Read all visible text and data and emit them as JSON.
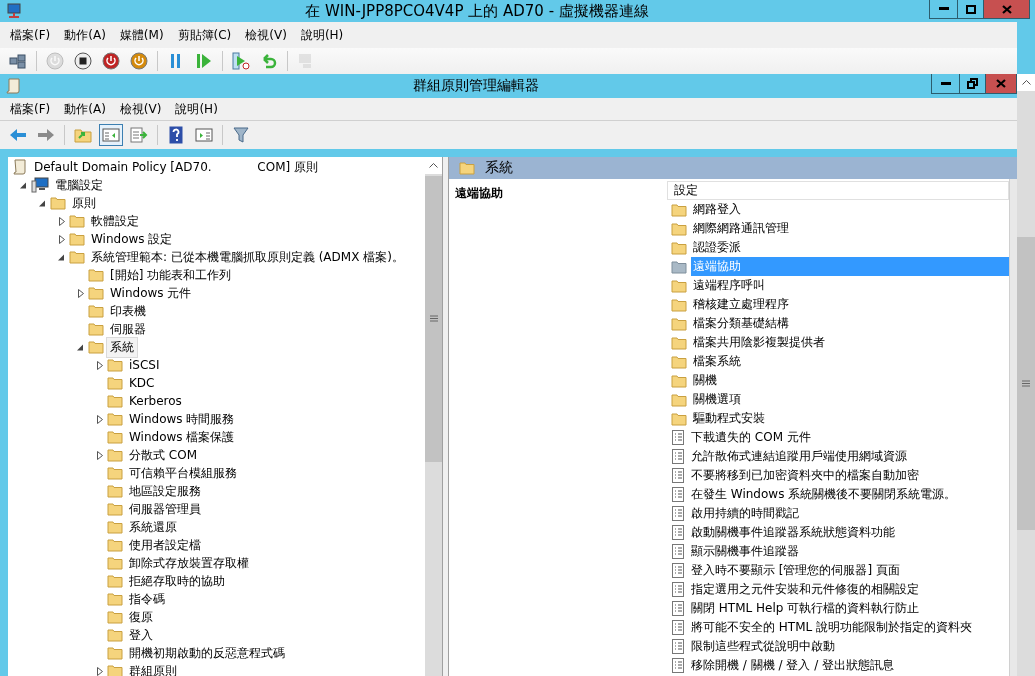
{
  "vm_window": {
    "title": "在 WIN-JPP8PCO4V4P 上的 AD70 - 虛擬機器連線",
    "menu": [
      "檔案(F)",
      "動作(A)",
      "媒體(M)",
      "剪貼簿(C)",
      "檢視(V)",
      "說明(H)"
    ],
    "toolbar": [
      [
        {
          "kind": "ctrl-alt-del",
          "disabled": false
        }
      ],
      [
        {
          "kind": "start",
          "disabled": true
        },
        {
          "kind": "stop",
          "disabled": false
        },
        {
          "kind": "shutdown",
          "disabled": false
        },
        {
          "kind": "save",
          "disabled": false
        }
      ],
      [
        {
          "kind": "pause",
          "disabled": false
        },
        {
          "kind": "resume",
          "disabled": false
        }
      ],
      [
        {
          "kind": "checkpoint",
          "disabled": false
        },
        {
          "kind": "revert",
          "disabled": false
        }
      ],
      [
        {
          "kind": "session",
          "disabled": true
        }
      ]
    ]
  },
  "editor_window": {
    "title": "群組原則管理編輯器",
    "menu": [
      "檔案(F)",
      "動作(A)",
      "檢視(V)",
      "說明(H)"
    ],
    "toolbar": [
      [
        {
          "kind": "back",
          "pressed": false
        },
        {
          "kind": "forward",
          "pressed": false
        }
      ],
      [
        {
          "kind": "up",
          "pressed": false
        },
        {
          "kind": "tree",
          "pressed": true
        },
        {
          "kind": "export",
          "pressed": false
        }
      ],
      [
        {
          "kind": "help",
          "pressed": false
        },
        {
          "kind": "pane",
          "pressed": false
        }
      ],
      [
        {
          "kind": "filter",
          "pressed": false
        }
      ]
    ]
  },
  "tree": [
    {
      "label": "Default Domain Policy [AD70.            COM] 原則",
      "kind": "policy",
      "selected": false,
      "children": [
        {
          "label": "電腦設定",
          "kind": "computer",
          "expanded": true,
          "selected": false,
          "children": [
            {
              "label": "原則",
              "kind": "folder",
              "expanded": true,
              "selected": false,
              "children": [
                {
                  "label": "軟體設定",
                  "kind": "folder",
                  "expanded": false,
                  "selected": false
                },
                {
                  "label": "Windows 設定",
                  "kind": "folder",
                  "expanded": false,
                  "selected": false
                },
                {
                  "label": "系統管理範本: 已從本機電腦抓取原則定義 (ADMX 檔案)。",
                  "kind": "folder",
                  "expanded": true,
                  "selected": false,
                  "children": [
                    {
                      "label": "[開始] 功能表和工作列",
                      "kind": "folder",
                      "selected": false
                    },
                    {
                      "label": "Windows 元件",
                      "kind": "folder",
                      "expanded": false,
                      "selected": false
                    },
                    {
                      "label": "印表機",
                      "kind": "folder",
                      "selected": false
                    },
                    {
                      "label": "伺服器",
                      "kind": "folder",
                      "selected": false
                    },
                    {
                      "label": "系統",
                      "kind": "folder",
                      "expanded": true,
                      "selected": true,
                      "children": [
                        {
                          "label": "iSCSI",
                          "kind": "folder",
                          "expanded": false,
                          "selected": false
                        },
                        {
                          "label": "KDC",
                          "kind": "folder",
                          "selected": false
                        },
                        {
                          "label": "Kerberos",
                          "kind": "folder",
                          "selected": false
                        },
                        {
                          "label": "Windows 時間服務",
                          "kind": "folder",
                          "expanded": false,
                          "selected": false
                        },
                        {
                          "label": "Windows 檔案保護",
                          "kind": "folder",
                          "selected": false
                        },
                        {
                          "label": "分散式 COM",
                          "kind": "folder",
                          "expanded": false,
                          "selected": false
                        },
                        {
                          "label": "可信賴平台模組服務",
                          "kind": "folder",
                          "selected": false
                        },
                        {
                          "label": "地區設定服務",
                          "kind": "folder",
                          "selected": false
                        },
                        {
                          "label": "伺服器管理員",
                          "kind": "folder",
                          "selected": false
                        },
                        {
                          "label": "系統還原",
                          "kind": "folder",
                          "selected": false
                        },
                        {
                          "label": "使用者設定檔",
                          "kind": "folder",
                          "selected": false
                        },
                        {
                          "label": "卸除式存放裝置存取權",
                          "kind": "folder",
                          "selected": false
                        },
                        {
                          "label": "拒絕存取時的協助",
                          "kind": "folder",
                          "selected": false
                        },
                        {
                          "label": "指令碼",
                          "kind": "folder",
                          "selected": false
                        },
                        {
                          "label": "復原",
                          "kind": "folder",
                          "selected": false
                        },
                        {
                          "label": "登入",
                          "kind": "folder",
                          "selected": false
                        },
                        {
                          "label": "開機初期啟動的反惡意程式碼",
                          "kind": "folder",
                          "selected": false
                        },
                        {
                          "label": "群組原則",
                          "kind": "folder",
                          "expanded": false,
                          "selected": false
                        }
                      ]
                    }
                  ]
                }
              ]
            }
          ]
        }
      ]
    }
  ],
  "details": {
    "header": "系統",
    "description_title": "遠端協助",
    "column": "設定",
    "items": [
      {
        "label": "網路登入",
        "kind": "folder",
        "selected": false
      },
      {
        "label": "網際網路通訊管理",
        "kind": "folder",
        "selected": false
      },
      {
        "label": "認證委派",
        "kind": "folder",
        "selected": false
      },
      {
        "label": "遠端協助",
        "kind": "folder",
        "selected": true
      },
      {
        "label": "遠端程序呼叫",
        "kind": "folder",
        "selected": false
      },
      {
        "label": "稽核建立處理程序",
        "kind": "folder",
        "selected": false
      },
      {
        "label": "檔案分類基礎結構",
        "kind": "folder",
        "selected": false
      },
      {
        "label": "檔案共用陰影複製提供者",
        "kind": "folder",
        "selected": false
      },
      {
        "label": "檔案系統",
        "kind": "folder",
        "selected": false
      },
      {
        "label": "關機",
        "kind": "folder",
        "selected": false
      },
      {
        "label": "關機選項",
        "kind": "folder",
        "selected": false
      },
      {
        "label": "驅動程式安裝",
        "kind": "folder",
        "selected": false
      },
      {
        "label": "下載遺失的 COM 元件",
        "kind": "setting",
        "selected": false
      },
      {
        "label": "允許散佈式連結追蹤用戶端使用網域資源",
        "kind": "setting",
        "selected": false
      },
      {
        "label": "不要將移到已加密資料夾中的檔案自動加密",
        "kind": "setting",
        "selected": false
      },
      {
        "label": "在發生 Windows 系統關機後不要關閉系統電源。",
        "kind": "setting",
        "selected": false
      },
      {
        "label": "啟用持續的時間戳記",
        "kind": "setting",
        "selected": false
      },
      {
        "label": "啟動關機事件追蹤器系統狀態資料功能",
        "kind": "setting",
        "selected": false
      },
      {
        "label": "顯示關機事件追蹤器",
        "kind": "setting",
        "selected": false
      },
      {
        "label": "登入時不要顯示 [管理您的伺服器] 頁面",
        "kind": "setting",
        "selected": false
      },
      {
        "label": "指定選用之元件安裝和元件修復的相關設定",
        "kind": "setting",
        "selected": false
      },
      {
        "label": "關閉 HTML Help 可執行檔的資料執行防止",
        "kind": "setting",
        "selected": false
      },
      {
        "label": "將可能不安全的 HTML 說明功能限制於指定的資料夾",
        "kind": "setting",
        "selected": false
      },
      {
        "label": "限制這些程式從說明中啟動",
        "kind": "setting",
        "selected": false
      },
      {
        "label": "移除開機 / 關機 / 登入 / 登出狀態訊息",
        "kind": "setting",
        "selected": false
      }
    ]
  }
}
